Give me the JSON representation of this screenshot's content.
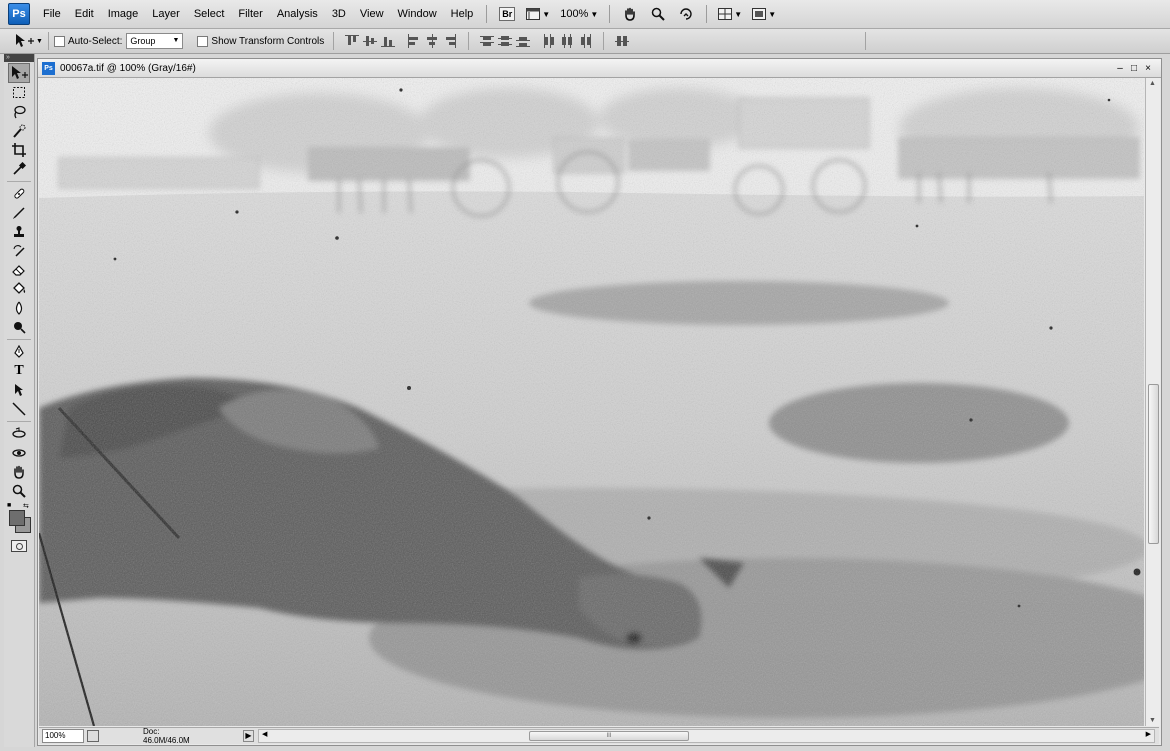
{
  "app": {
    "logo": "Ps"
  },
  "menu": [
    "File",
    "Edit",
    "Image",
    "Layer",
    "Select",
    "Filter",
    "Analysis",
    "3D",
    "View",
    "Window",
    "Help"
  ],
  "menubar_controls": {
    "bridge_label": "Br",
    "zoom_value": "100%"
  },
  "options": {
    "auto_select_label": "Auto-Select:",
    "auto_select_value": "Group",
    "auto_select_checked": false,
    "show_transform_label": "Show Transform Controls",
    "show_transform_checked": false
  },
  "tools": [
    "move-tool",
    "marquee-tool",
    "lasso-tool",
    "quick-selection-tool",
    "crop-tool",
    "eyedropper-tool",
    "spot-healing-tool",
    "brush-tool",
    "clone-stamp-tool",
    "history-brush-tool",
    "eraser-tool",
    "paint-bucket-tool",
    "blur-tool",
    "dodge-tool",
    "pen-tool",
    "type-tool",
    "path-selection-tool",
    "line-tool",
    "3d-rotate-tool",
    "3d-orbit-tool",
    "hand-tool",
    "zoom-tool"
  ],
  "tool_type_letter": "T",
  "swatches": {
    "foreground": "#6e6e6e",
    "background": "#979797"
  },
  "document": {
    "title": "00067a.tif @ 100% (Gray/16#)",
    "ps_badge": "Ps",
    "window_controls": [
      "–",
      "□",
      "×"
    ]
  },
  "status": {
    "zoom": "100%",
    "doc_size": "Doc: 46.0M/46.0M",
    "scroll_grip": "III"
  },
  "colors": {
    "ps_blue": "#1d6fd0",
    "panel_bg": "#d6d6d6"
  }
}
